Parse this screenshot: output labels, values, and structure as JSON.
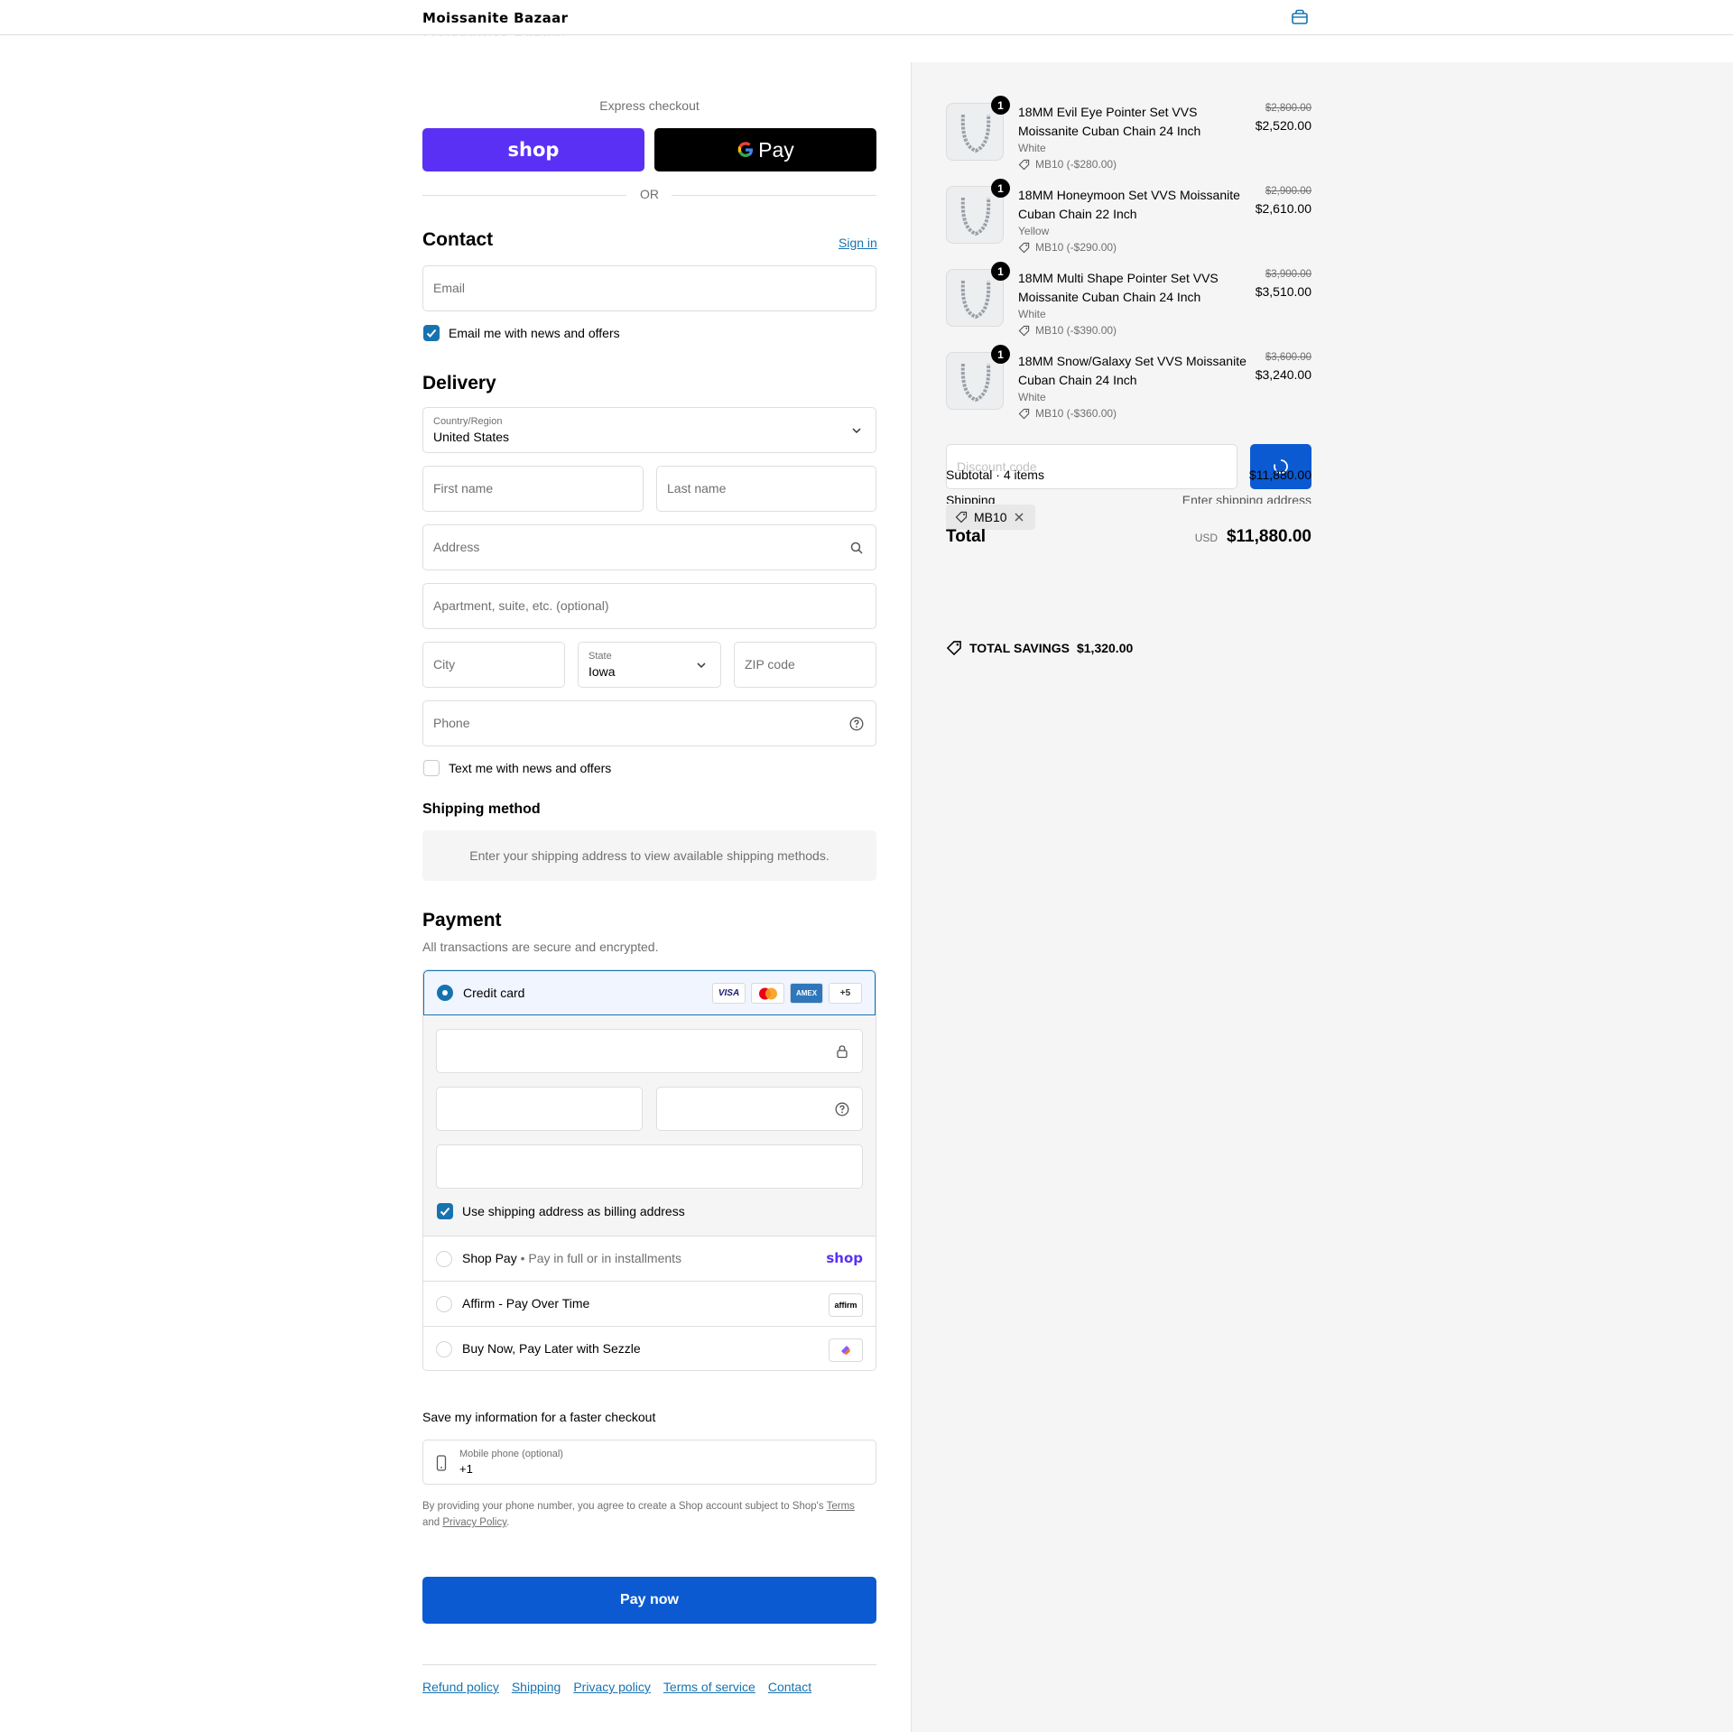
{
  "header": {
    "store_name": "Moissanite Bazaar"
  },
  "express": {
    "label": "Express checkout",
    "shop_label": "shop",
    "gpay_label": "Pay",
    "or_label": "OR"
  },
  "contact": {
    "title": "Contact",
    "sign_in": "Sign in",
    "email_placeholder": "Email",
    "news_label": "Email me with news and offers",
    "news_checked": true
  },
  "delivery": {
    "title": "Delivery",
    "country_label": "Country/Region",
    "country_value": "United States",
    "first_name": "First name",
    "last_name": "Last name",
    "address": "Address",
    "apartment": "Apartment, suite, etc. (optional)",
    "city": "City",
    "state_label": "State",
    "state_value": "Iowa",
    "zip": "ZIP code",
    "phone": "Phone",
    "text_label": "Text me with news and offers",
    "text_checked": false
  },
  "shipping_method": {
    "title": "Shipping method",
    "message": "Enter your shipping address to view available shipping methods."
  },
  "payment": {
    "title": "Payment",
    "subtitle": "All transactions are secure and encrypted.",
    "credit_card": "Credit card",
    "cards": [
      "VISA",
      "MC",
      "AMEX",
      "+5"
    ],
    "billing_label": "Use shipping address as billing address",
    "shop_pay": "Shop Pay",
    "shop_pay_sub": "Pay in full or in installments",
    "shop_pay_badge": "shop",
    "affirm": "Affirm - Pay Over Time",
    "affirm_badge": "affirm",
    "sezzle": "Buy Now, Pay Later with Sezzle"
  },
  "save_info": {
    "title": "Save my information for a faster checkout",
    "mobile_label": "Mobile phone (optional)",
    "mobile_value": "+1",
    "legal_prefix": "By providing your phone number, you agree to create a Shop account subject to Shop's",
    "terms": "Terms",
    "and": "and",
    "privacy": "Privacy Policy"
  },
  "pay_now": "Pay now",
  "footer_links": [
    "Refund policy",
    "Shipping",
    "Privacy policy",
    "Terms of service",
    "Contact"
  ],
  "summary": {
    "items": [
      {
        "qty": "1",
        "name": "18MM Evil Eye Pointer Set VVS Moissanite Cuban Chain 24 Inch",
        "variant": "White",
        "discount": "MB10 (-$280.00)",
        "old_price": "$2,800.00",
        "price": "$2,520.00"
      },
      {
        "qty": "1",
        "name": "18MM Honeymoon Set VVS Moissanite Cuban Chain 22 Inch",
        "variant": "Yellow",
        "discount": "MB10 (-$290.00)",
        "old_price": "$2,900.00",
        "price": "$2,610.00"
      },
      {
        "qty": "1",
        "name": "18MM Multi Shape Pointer Set VVS Moissanite Cuban Chain 24 Inch",
        "variant": "White",
        "discount": "MB10 (-$390.00)",
        "old_price": "$3,900.00",
        "price": "$3,510.00"
      },
      {
        "qty": "1",
        "name": "18MM Snow/Galaxy Set VVS Moissanite Cuban Chain 24 Inch",
        "variant": "White",
        "discount": "MB10 (-$360.00)",
        "old_price": "$3,600.00",
        "price": "$3,240.00"
      }
    ],
    "discount_placeholder": "Discount code",
    "subtotal_label": "Subtotal · 4 items",
    "subtotal_value": "$11,880.00",
    "shipping_label": "Shipping",
    "shipping_value": "Enter shipping address",
    "code_chip": "MB10",
    "total_label": "Total",
    "currency": "USD",
    "total_value": "$11,880.00",
    "savings_label": "TOTAL SAVINGS",
    "savings_value": "$1,320.00"
  },
  "colors": {
    "accent": "#1773b0",
    "pay_button": "#0b5ad1",
    "shop_purple": "#5a31f4"
  }
}
